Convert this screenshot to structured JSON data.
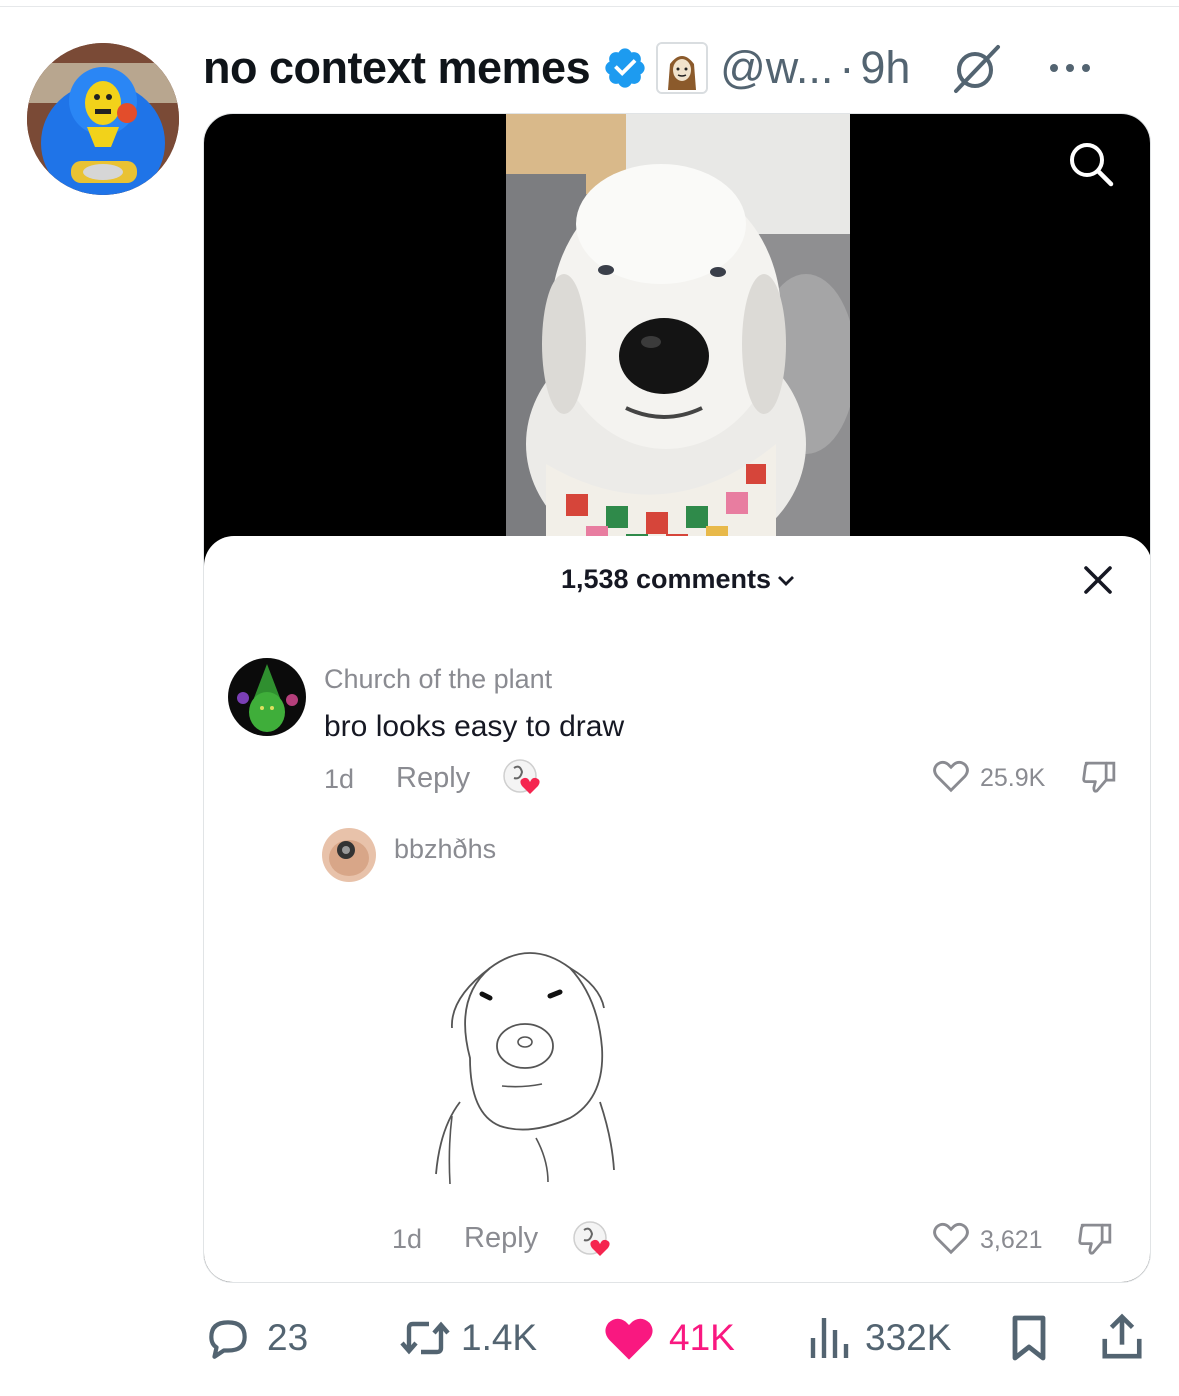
{
  "post": {
    "display_name": "no context memes",
    "handle": "@w...",
    "separator": "·",
    "time": "9h"
  },
  "comments_sheet": {
    "count_label": "1,538 comments",
    "comments": [
      {
        "author": "Church of the plant",
        "text": "bro looks easy to draw",
        "age": "1d",
        "reply_label": "Reply",
        "likes": "25.9K"
      },
      {
        "author": "bbzhðhs",
        "text": "",
        "age": "1d",
        "reply_label": "Reply",
        "likes": "3,621"
      }
    ]
  },
  "actions": {
    "replies": "23",
    "reposts": "1.4K",
    "likes": "41K",
    "views": "332K"
  },
  "colors": {
    "verified_blue": "#1d9bf0",
    "like_pink": "#f91880",
    "secondary_text": "#536471"
  },
  "icons": [
    "verified-icon",
    "grok-icon",
    "more-icon",
    "search-icon",
    "close-icon",
    "heart-icon",
    "dislike-icon",
    "reply-icon",
    "repost-icon",
    "views-icon",
    "bookmark-icon",
    "share-icon"
  ]
}
